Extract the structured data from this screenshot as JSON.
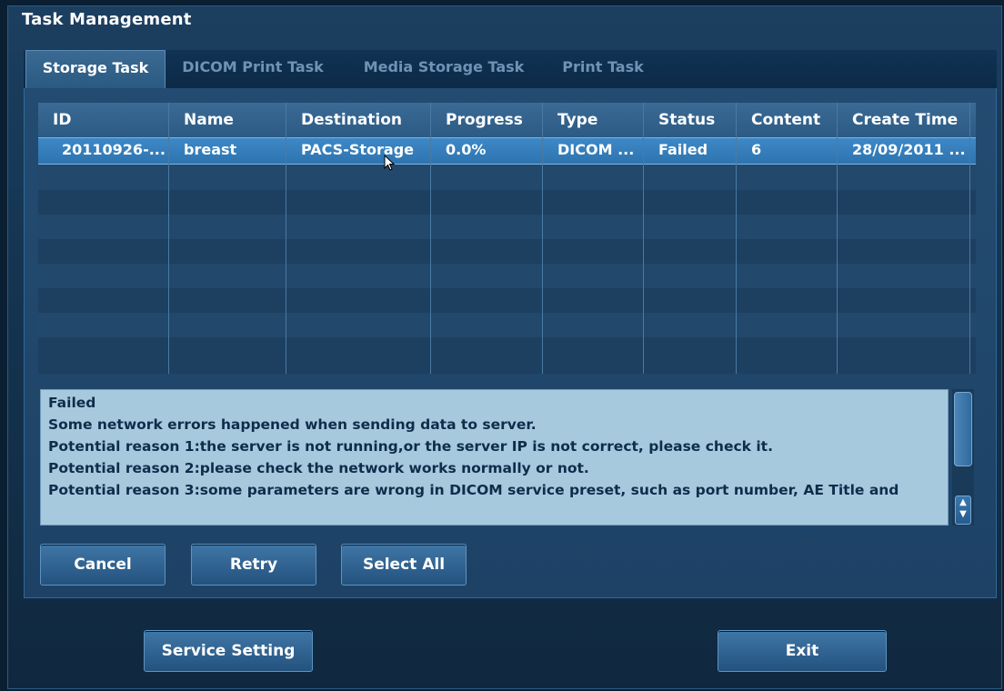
{
  "window": {
    "title": "Task Management"
  },
  "tabs": [
    {
      "label": "Storage Task",
      "active": true
    },
    {
      "label": "DICOM Print Task",
      "active": false
    },
    {
      "label": "Media Storage Task",
      "active": false
    },
    {
      "label": "Print Task",
      "active": false
    }
  ],
  "table": {
    "columns": [
      "ID",
      "Name",
      "Destination",
      "Progress",
      "Type",
      "Status",
      "Content",
      "Create Time"
    ],
    "rows": [
      {
        "id": "20110926-...",
        "name": "breast",
        "destination": "PACS-Storage",
        "progress": "0.0%",
        "type": "DICOM ...",
        "status": "Failed",
        "content": "6",
        "create_time": "28/09/2011 ...",
        "selected": true
      }
    ]
  },
  "detail": {
    "lines": [
      "Failed",
      "Some network errors happened when sending data to server.",
      "Potential reason 1:the server is not running,or the server IP is not correct, please check it.",
      "Potential reason 2:please check the network works normally or not.",
      "Potential reason 3:some parameters are wrong in DICOM service preset, such as port number, AE Title and"
    ]
  },
  "buttons": {
    "cancel": "Cancel",
    "retry": "Retry",
    "select_all": "Select All",
    "service_setting": "Service Setting",
    "exit": "Exit"
  },
  "colors": {
    "selected_row": "#3e88c6",
    "detail_bg": "#a7c9de",
    "panel_bg": "#244c72"
  },
  "icons": {
    "scroll_arrows": "scroll-updown-icon",
    "cursor": "mouse-pointer-icon"
  }
}
